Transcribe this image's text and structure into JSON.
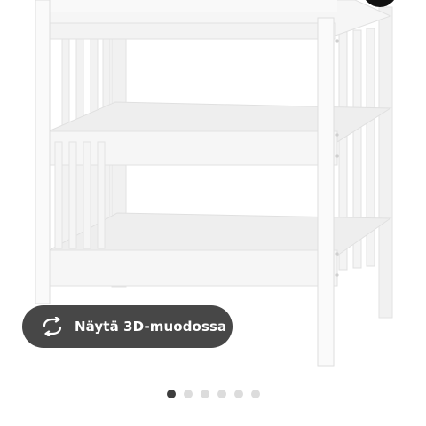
{
  "view_3d": {
    "label": "Näytä 3D-muodossa",
    "icon": "rotate-3d-icon"
  },
  "carousel": {
    "total": 6,
    "active_index": 0
  },
  "product_image": {
    "icon": "changing-table-image"
  },
  "colors": {
    "button_bg": "#474747",
    "dot_active": "#3d3d3d",
    "dot_inactive": "#dcdcdc",
    "furniture_white": "#f7f7f7"
  }
}
